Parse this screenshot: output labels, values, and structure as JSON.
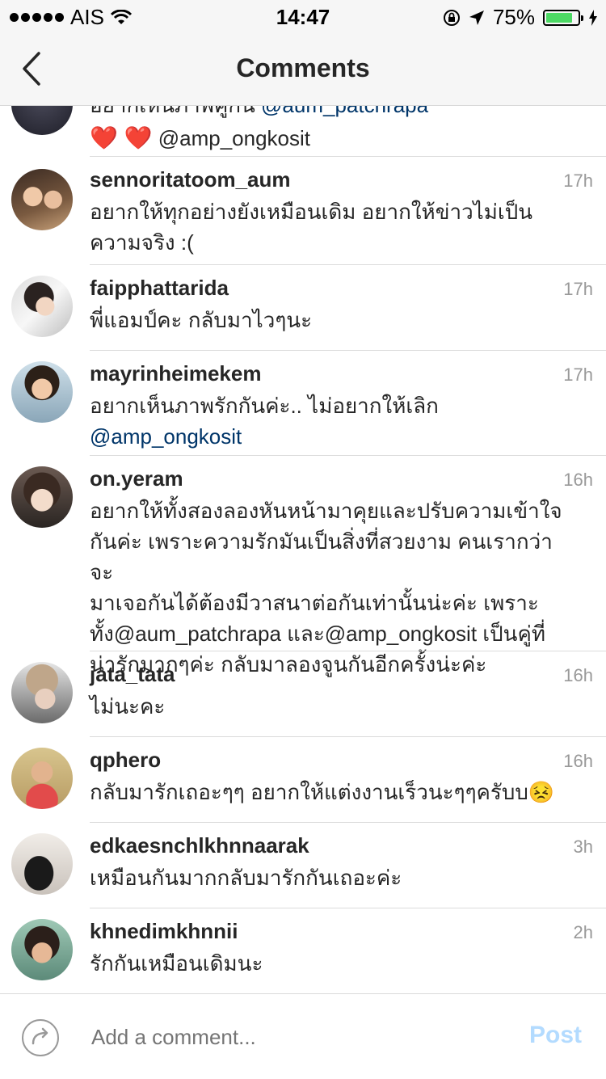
{
  "status_bar": {
    "carrier": "AIS",
    "time": "14:47",
    "battery_percent": "75%",
    "battery_level": 0.75
  },
  "nav": {
    "title": "Comments"
  },
  "partial_comment": {
    "line1_text": "อยากเห็นภาพคู่กัน",
    "line1_mention": "@aum_patchrapa",
    "line2_mention": "@amp_ongkosit"
  },
  "comments": [
    {
      "username": "sennoritatoom_aum",
      "time": "17h",
      "lines": [
        "อยากให้ทุกอย่างยังเหมือนเดิม อยากให้ข่าวไม่เป็น",
        "ความจริง :("
      ]
    },
    {
      "username": "faipphattarida",
      "time": "17h",
      "lines": [
        "พี่แอมป์คะ กลับมาไวๆนะ"
      ]
    },
    {
      "username": "mayrinheimekem",
      "time": "17h",
      "lines": [
        "อยากเห็นภาพรักกันค่ะ.. ไม่อยากให้เลิก"
      ],
      "mention": "@amp_ongkosit"
    },
    {
      "username": "on.yeram",
      "time": "16h",
      "lines": [
        "อยากให้ทั้งสองลองหันหน้ามาคุยและปรับความเข้าใจ",
        "กันค่ะ เพราะความรักมันเป็นสิ่งที่สวยงาม คนเรากว่าจะ",
        "มาเจอกันได้ต้องมีวาสนาต่อกันเท่านั้นน่ะค่ะ เพราะ",
        "ทั้ง@aum_patchrapa และ@amp_ongkosit เป็นคู่ที่",
        "น่ารักมากๆค่ะ กลับมาลองจูนกันอีกครั้งน่ะค่ะ"
      ]
    },
    {
      "username": "jata_tata",
      "time": "16h",
      "lines": [
        "ไม่นะคะ"
      ]
    },
    {
      "username": "qphero",
      "time": "16h",
      "lines": [
        "กลับมารักเถอะๆๆ อยากให้แต่งงานเร็วนะๆๆครับบ😣"
      ]
    },
    {
      "username": "edkaesnchlkhnnaarak",
      "time": "3h",
      "lines": [
        "เหมือนกันมากกลับมารักกันเถอะค่ะ"
      ]
    },
    {
      "username": "khnedimkhnnii",
      "time": "2h",
      "lines": [
        "รักกันเหมือนเดิมนะ"
      ]
    }
  ],
  "composer": {
    "placeholder": "Add a comment...",
    "post_label": "Post"
  },
  "colors": {
    "bar_bg": "#f6f6f6",
    "mention": "#003569",
    "post_disabled": "#b3dbff",
    "battery": "#4cd964"
  }
}
